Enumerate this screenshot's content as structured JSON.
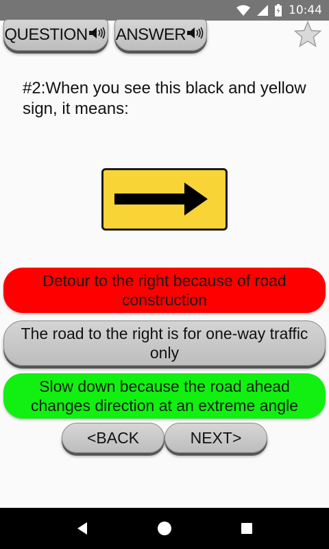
{
  "status_bar": {
    "time": "10:44"
  },
  "toolbar": {
    "question_label": "QUESTION",
    "answer_label": "ANSWER"
  },
  "question": {
    "text": "#2:When you see this black and yellow sign, it means:"
  },
  "options": [
    {
      "text": "Detour to the right because of road construction",
      "color": "#ff0000"
    },
    {
      "text": "The road to the right is for one-way traffic only",
      "color": "#c8c8c8"
    },
    {
      "text": "Slow down because the road ahead changes direction at an extreme angle",
      "color": "#12f012"
    }
  ],
  "navigation": {
    "back_label": "<BACK",
    "next_label": "NEXT>"
  },
  "colors": {
    "sign_yellow": "#f9d437",
    "status_bar": "#757575"
  }
}
